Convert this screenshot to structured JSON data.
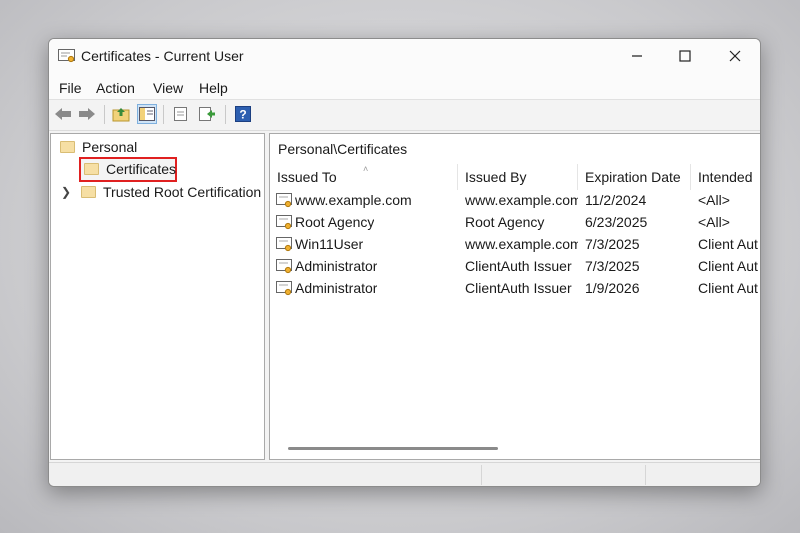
{
  "window": {
    "title": "Certificates - Current User"
  },
  "menu": [
    "File",
    "Action",
    "View",
    "Help"
  ],
  "toolbar": {
    "buttons": [
      "back-arrow-icon",
      "forward-arrow-icon",
      "folder-up-icon",
      "show-hide-console-tree-icon",
      "export-list-icon",
      "properties-icon",
      "help-icon"
    ]
  },
  "tree": {
    "items": [
      {
        "label": "Personal",
        "expanded": true
      },
      {
        "label": "Certificates",
        "selected": true
      },
      {
        "label": "Trusted Root Certification",
        "expandable": true
      }
    ]
  },
  "list": {
    "path": "Personal\\Certificates",
    "columns": [
      "Issued To",
      "Issued By",
      "Expiration Date",
      "Intended"
    ],
    "rows": [
      {
        "issued_to": "www.example.com",
        "issued_by": "www.example.com",
        "expiration": "11/2/2024",
        "intended": "<All>"
      },
      {
        "issued_to": "Root Agency",
        "issued_by": "Root Agency",
        "expiration": "6/23/2025",
        "intended": "<All>"
      },
      {
        "issued_to": "Win11User",
        "issued_by": "www.example.com",
        "expiration": "7/3/2025",
        "intended": "Client Aut"
      },
      {
        "issued_to": "Administrator",
        "issued_by": "ClientAuth Issuer",
        "expiration": "7/3/2025",
        "intended": "Client Aut"
      },
      {
        "issued_to": "Administrator",
        "issued_by": "ClientAuth Issuer",
        "expiration": "1/9/2026",
        "intended": "Client Aut"
      }
    ]
  },
  "colors": {
    "selection_outline": "#e02020",
    "folder": "#f6dfa4",
    "window_bg": "#f3f3f3"
  }
}
